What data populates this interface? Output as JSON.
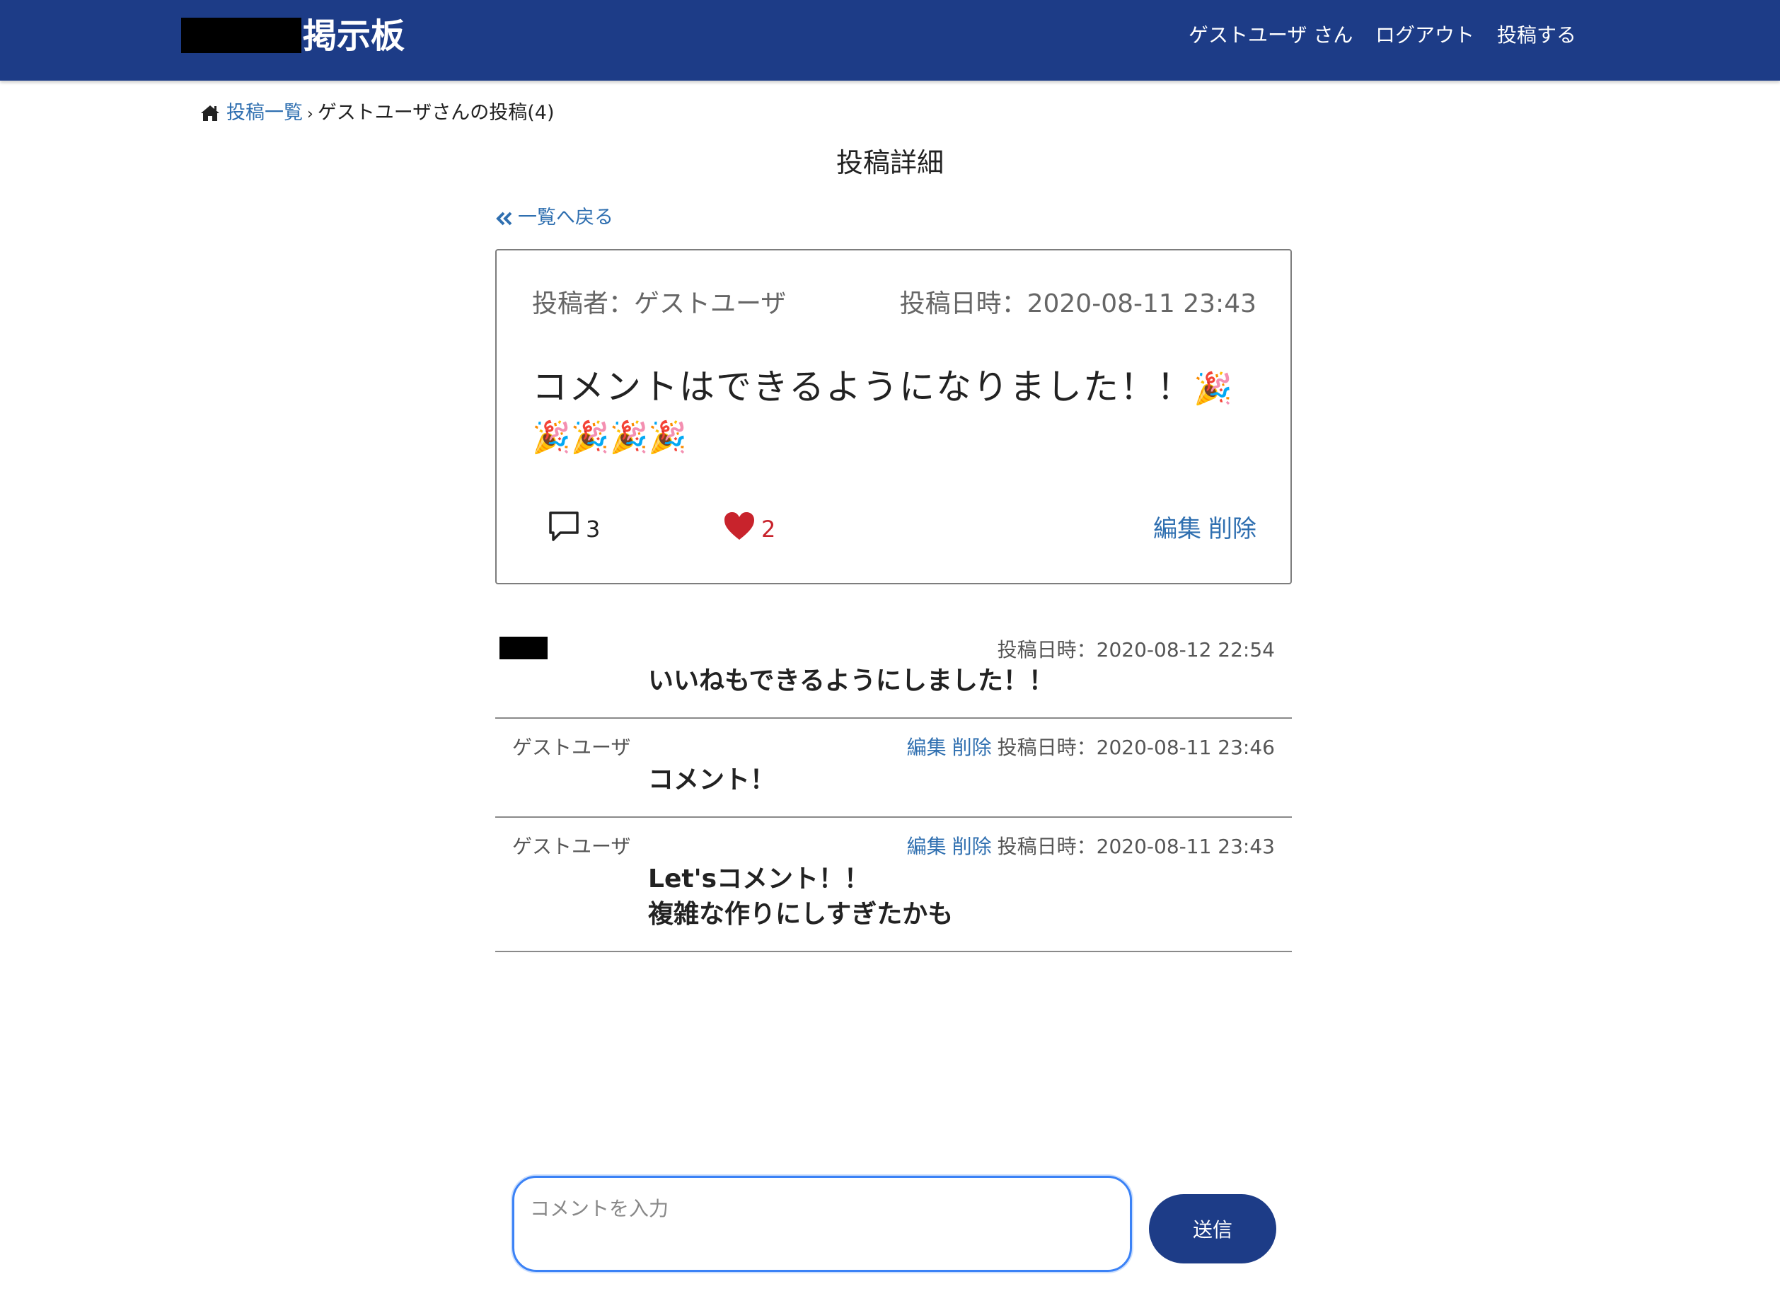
{
  "header": {
    "site_title": "掲示板",
    "user_label": "ゲストユーザ さん",
    "logout_label": "ログアウト",
    "new_post_label": "投稿する"
  },
  "breadcrumb": {
    "home_icon": "home-icon",
    "list_link": "投稿一覧",
    "separator": "›",
    "current": "ゲストユーザさんの投稿(4)"
  },
  "page": {
    "title": "投稿詳細",
    "back_link": "一覧へ戻る",
    "back_icon": "double-chevron-left-icon"
  },
  "post": {
    "author": "投稿者：ゲストユーザ",
    "date": "投稿日時：2020-08-11 23:43",
    "body": "コメントはできるようになりました！！",
    "emojis": "🎉🎉🎉🎉🎉",
    "comment_count": "3",
    "like_count": "2",
    "edit_label": "編集",
    "delete_label": "削除",
    "like_color": "#c8232c"
  },
  "comments": [
    {
      "author": "",
      "edit_label": "",
      "delete_label": "",
      "date": "投稿日時：2020-08-12 22:54",
      "text": "いいねもできるようにしました！！"
    },
    {
      "author": "ゲストユーザ",
      "edit_label": "編集",
      "delete_label": "削除",
      "date": "投稿日時：2020-08-11 23:46",
      "text": "コメント！"
    },
    {
      "author": "ゲストユーザ",
      "edit_label": "編集",
      "delete_label": "削除",
      "date": "投稿日時：2020-08-11 23:43",
      "text": "Let'sコメント！！",
      "text_line2": "複雑な作りにしすぎたかも"
    }
  ],
  "form": {
    "placeholder": "コメントを入力",
    "value": "",
    "submit_label": "送信"
  },
  "colors": {
    "header_bg": "#1d3c87",
    "link": "#2f6fb0",
    "accent": "#c8232c"
  }
}
